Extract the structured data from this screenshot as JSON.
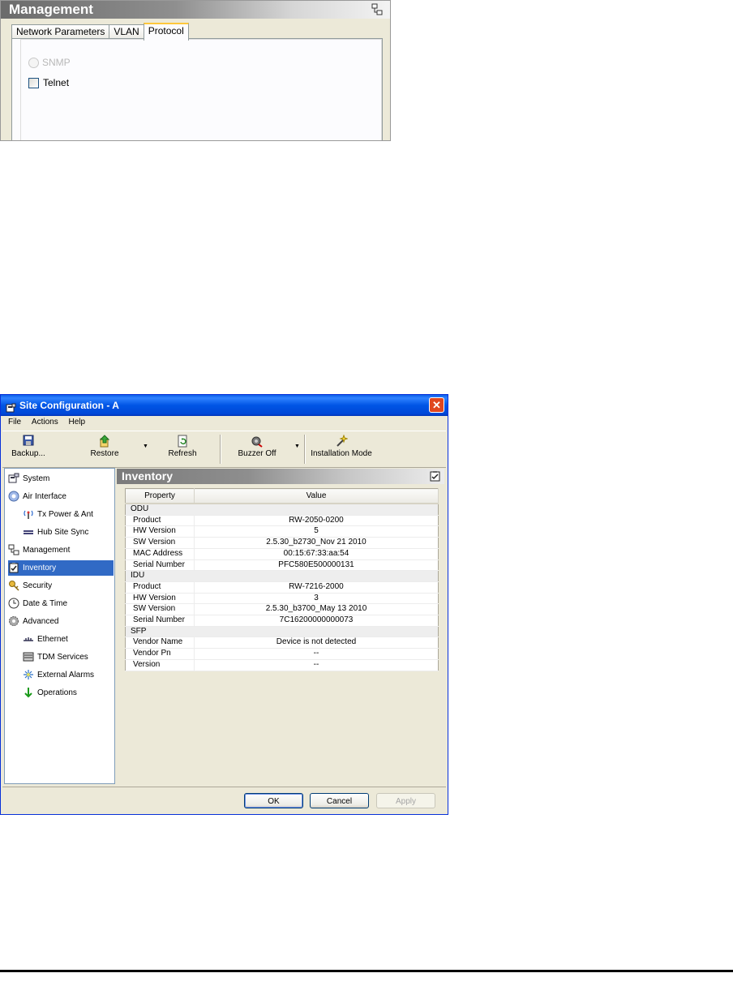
{
  "management_panel": {
    "title": "Management",
    "tabs": [
      "Network Parameters",
      "VLAN",
      "Protocol"
    ],
    "active_tab": "Protocol",
    "options": [
      {
        "label": "SNMP",
        "type": "radio",
        "disabled": true
      },
      {
        "label": "Telnet",
        "type": "checkbox",
        "checked": false
      }
    ]
  },
  "window": {
    "title": "Site Configuration - A",
    "close_glyph": "✕",
    "menu": [
      "File",
      "Actions",
      "Help"
    ],
    "toolbar": {
      "backup": "Backup...",
      "restore": "Restore",
      "refresh": "Refresh",
      "buzzer": "Buzzer Off",
      "installation": "Installation Mode"
    },
    "nav": [
      {
        "label": "System",
        "icon": "system-icon"
      },
      {
        "label": "Air Interface",
        "icon": "globe-icon"
      },
      {
        "label": "Tx Power & Ant",
        "icon": "antenna-icon"
      },
      {
        "label": "Hub Site Sync",
        "icon": "sync-icon"
      },
      {
        "label": "Management",
        "icon": "network-icon"
      },
      {
        "label": "Inventory",
        "icon": "clipboard-icon",
        "selected": true
      },
      {
        "label": "Security",
        "icon": "key-icon"
      },
      {
        "label": "Date & Time",
        "icon": "clock-icon"
      },
      {
        "label": "Advanced",
        "icon": "gear-icon"
      },
      {
        "label": "Ethernet",
        "icon": "ethernet-icon"
      },
      {
        "label": "TDM Services",
        "icon": "tdm-icon"
      },
      {
        "label": "External Alarms",
        "icon": "alarm-icon"
      },
      {
        "label": "Operations",
        "icon": "arrow-down-icon"
      }
    ],
    "content_title": "Inventory",
    "table": {
      "headers": [
        "Property",
        "Value"
      ],
      "groups": [
        {
          "name": "ODU",
          "rows": [
            [
              "Product",
              "RW-2050-0200"
            ],
            [
              "HW Version",
              "5"
            ],
            [
              "SW Version",
              "2.5.30_b2730_Nov 21 2010"
            ],
            [
              "MAC Address",
              "00:15:67:33:aa:54"
            ],
            [
              "Serial Number",
              "PFC580E500000131"
            ]
          ]
        },
        {
          "name": "IDU",
          "rows": [
            [
              "Product",
              "RW-7216-2000"
            ],
            [
              "HW Version",
              "3"
            ],
            [
              "SW Version",
              "2.5.30_b3700_May 13 2010"
            ],
            [
              "Serial Number",
              "7C16200000000073"
            ]
          ]
        },
        {
          "name": "SFP",
          "rows": [
            [
              "Vendor Name",
              "Device is not detected"
            ],
            [
              "Vendor Pn",
              "--"
            ],
            [
              "Version",
              "--"
            ]
          ]
        }
      ]
    },
    "buttons": {
      "ok": "OK",
      "cancel": "Cancel",
      "apply": "Apply"
    }
  }
}
